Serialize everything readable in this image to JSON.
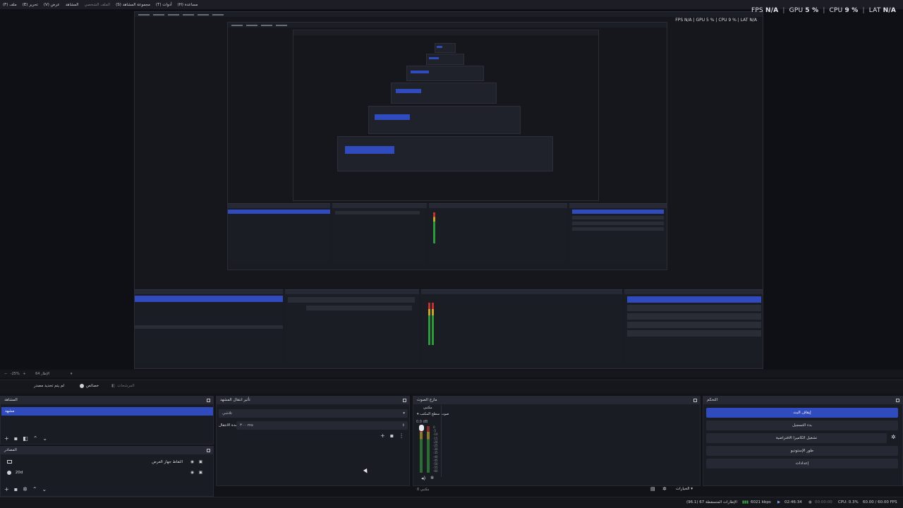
{
  "menubar": {
    "items": [
      "ملف (F)",
      "تحرير (E)",
      "عرض (V)",
      "الملفات الشخصية",
      "مجموعة المشاهد (S)",
      "أدوات (T)",
      "مساعدة (H)"
    ],
    "items_display": [
      "(F) ملف",
      "(E) تحرير",
      "(V) عرض",
      "المشاهد",
      "الملف الشخصي",
      "(S) مجموعة المشاهد",
      "(T) أدوات",
      "(H) مساعدة"
    ]
  },
  "stats": {
    "fps_label": "FPS",
    "fps_value": "N/A",
    "gpu_label": "GPU",
    "gpu_value": "5 %",
    "cpu_label": "CPU",
    "cpu_value": "9 %",
    "lat_label": "LAT",
    "lat_value": "N/A",
    "separator": "|"
  },
  "zoom": {
    "value": "-25%",
    "label": "الإطار 64"
  },
  "modes": {
    "studio": "لم يتم تحديد مصدر",
    "props": "خصائص",
    "filters": "المرشحات"
  },
  "scenes": {
    "title": "المشاهد",
    "items": [
      "مشهد"
    ]
  },
  "sources": {
    "title": "المصادر",
    "items": [
      {
        "label": "التقاط جهاز العرض",
        "icon": "monitor-icon"
      },
      {
        "label": "20d",
        "icon": "globe-icon"
      }
    ]
  },
  "transitions": {
    "title": "تأثير انتقال المشهد",
    "combo": "تلاشي",
    "duration_label": "مدة الانتقال",
    "duration_value": "٣٠٠ ms"
  },
  "audio": {
    "title": "مازج الصوت",
    "tab": "مكتبي",
    "device": "صوت سطح المكتب",
    "db": "0.0 dB",
    "ticks": [
      "0",
      "-5",
      "-10",
      "-15",
      "-20",
      "-25",
      "-30",
      "-35",
      "-40",
      "-45",
      "-50",
      "-55",
      "-60"
    ],
    "footer": "مكتبي 0",
    "settings_label": "الخيارات"
  },
  "controls": {
    "title": "التحكم",
    "buttons": [
      "إيقاف البث",
      "بدء التسجيل",
      "تشغيل الكاميرا الافتراضية",
      "طور الإستوديو",
      "إعدادات"
    ]
  },
  "status": {
    "frames": "(96.1) 67 الإطارات المتسقطة",
    "bitrate": "6021 kbps",
    "live_time": "02:46:34",
    "rec_time": "00:00:00",
    "cpu": "CPU: 0.3%",
    "fps": "60.00 / 60.00 FPS"
  },
  "colors": {
    "accent": "#2f4bbd",
    "background": "#121318",
    "panel": "#1a1c23"
  }
}
